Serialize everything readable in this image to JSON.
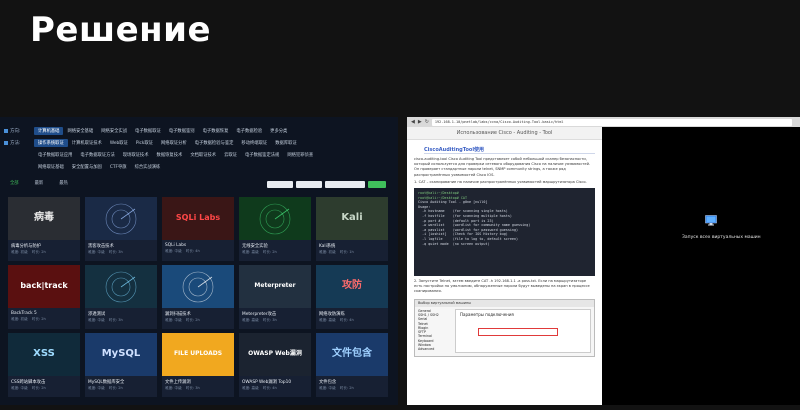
{
  "slide": {
    "title": "Решение"
  },
  "left": {
    "nav_rows": [
      {
        "label": "方向:",
        "cats": [
          "计算机基础",
          "网络安全基础",
          "网络安全实战",
          "电子数据取证",
          "电子数据鉴别",
          "电子数据恢复",
          "电子数据检验",
          "更多分类"
        ],
        "active": 0
      },
      {
        "label": "方法:",
        "cats": [
          "操作系统取证",
          "计算机取证技术",
          "Web取证",
          "Pick取证",
          "网络取证分析",
          "电子数据检验与鉴定",
          "移动终端取证",
          "数据库取证"
        ],
        "active": 0
      },
      {
        "label": "",
        "cats": [
          "电子数据取证应用",
          "电子数据取证方法",
          "现场取证技术",
          "数据恢复技术",
          "文档取证技术",
          "云取证",
          "电子数据鉴定法规",
          "网络犯罪侦查"
        ],
        "active": -1
      },
      {
        "label": "",
        "cats": [
          "网络取证基础",
          "安全配置与加固",
          "CTF夺旗",
          "综合实战演练"
        ],
        "active": -1
      }
    ],
    "filters": [
      "全部",
      "最新",
      "最热"
    ],
    "active_filter": 0,
    "cards": [
      {
        "name": "病毒分析与防护",
        "meta": [
          "难度: 初级",
          "时长: 2h"
        ],
        "thumb_text": "病毒",
        "bg": "#2a2d33",
        "fg": "#e8e8e8"
      },
      {
        "name": "黑客攻击技术",
        "meta": [
          "难度: 中级",
          "时长: 3h"
        ],
        "thumb_text": "",
        "bg": "#1a2a46",
        "fg": "#9fc2ff"
      },
      {
        "name": "SQLi Labs",
        "meta": [
          "难度: 中级",
          "时长: 4h"
        ],
        "thumb_text": "SQLi Labs",
        "bg": "#3a1616",
        "fg": "#ff4747"
      },
      {
        "name": "无线安全实验",
        "meta": [
          "难度: 高级",
          "时长: 2h"
        ],
        "thumb_text": "",
        "bg": "#0f3a1c",
        "fg": "#44e07a"
      },
      {
        "name": "Kali系统",
        "meta": [
          "难度: 初级",
          "时长: 1h"
        ],
        "thumb_text": "Kali",
        "bg": "#2d3c2e",
        "fg": "#c8d8c8"
      },
      {
        "name": "BackTrack 5",
        "meta": [
          "难度: 初级",
          "时长: 2h"
        ],
        "thumb_text": "back|track",
        "bg": "#5a1010",
        "fg": "#ffffff"
      },
      {
        "name": "渗透测试",
        "meta": [
          "难度: 中级",
          "时长: 3h"
        ],
        "thumb_text": "",
        "bg": "#143040",
        "fg": "#7fd7ff"
      },
      {
        "name": "漏洞扫描技术",
        "meta": [
          "难度: 中级",
          "时长: 2h"
        ],
        "thumb_text": "",
        "bg": "#1a4a7a",
        "fg": "#ffffff"
      },
      {
        "name": "Meterpreter攻击",
        "meta": [
          "难度: 高级",
          "时长: 3h"
        ],
        "thumb_text": "Meterpreter",
        "bg": "#223040",
        "fg": "#ffffff"
      },
      {
        "name": "网络攻防演练",
        "meta": [
          "难度: 高级",
          "时长: 4h"
        ],
        "thumb_text": "攻防",
        "bg": "#153a55",
        "fg": "#ff6b6b"
      },
      {
        "name": "CSS跨站脚本攻击",
        "meta": [
          "难度: 中级",
          "时长: 2h"
        ],
        "thumb_text": "XSS",
        "bg": "#102a3a",
        "fg": "#9fdcff"
      },
      {
        "name": "MySQL数据库安全",
        "meta": [
          "难度: 中级",
          "时长: 2h"
        ],
        "thumb_text": "MySQL",
        "bg": "#1a3a6a",
        "fg": "#cfe0ff"
      },
      {
        "name": "文件上传漏洞",
        "meta": [
          "难度: 中级",
          "时长: 3h"
        ],
        "thumb_text": "FILE UPLOADS",
        "bg": "#f1a81f",
        "fg": "#ffffff"
      },
      {
        "name": "OWASP Web漏洞 Top10",
        "meta": [
          "难度: 高级",
          "时长: 4h"
        ],
        "thumb_text": "OWASP Web漏洞",
        "bg": "#1b2330",
        "fg": "#ffffff"
      },
      {
        "name": "文件包含",
        "meta": [
          "难度: 中级",
          "时长: 2h"
        ],
        "thumb_text": "文件包含",
        "bg": "#1a3a6a",
        "fg": "#9fd0ff"
      }
    ]
  },
  "right": {
    "browser": {
      "back": "◀",
      "forward": "▶",
      "reload": "↻",
      "url": "192.168.1.10/pnetlab/labs/ccna/Cisco-Auditing-Tool-basic/html"
    },
    "doc_header": "Использование Cisco - Auditing - Tool",
    "doc_heading": "CiscoAuditingTool使用",
    "paragraphs": [
      "cisco-auditing-tool  Cisco Auditing Tool представляет собой небольшой сканер безопасности, который используется для проверки сетевого оборудования Cisco на наличие уязвимостей. Он проверяет стандартные пароли telnet, SNMP community strings, а также ряд распространённых уязвимостей Cisco IOS.",
      "1. CAT – сканирование на наличие распространённых уязвимостей маршрутизатора Cisco."
    ],
    "terminal_lines": [
      "root@kali:~/Desktop#",
      "root@kali:~/Desktop# CAT",
      "",
      "Cisco Auditing Tool - g0ne [null0]",
      "Usage:",
      "  -h hostname    (for scanning single hosts)",
      "  -f hostfile    (for scanning multiple hosts)",
      "  -p port #      (default port is 23)",
      "  -w wordlist    (wordlist for community name guessing)",
      "  -a passlist    (wordlist for password guessing)",
      "  -i [ioshist]   (Check for IOS History bug)",
      "  -l logfile     (file to log to, default screen)",
      "  -q quiet mode  (no screen output)"
    ],
    "after_term": "2. Запустите Telnet, затем введите CAT -h 192.168.1.1 -a pass.txt. Если на маршрутизаторе есть настройки по умолчанию, обнаруженные пароли будут выведены на экран в процессе сканирования.",
    "window_title": "Выбор виртуальной машины",
    "window_tree": [
      "General",
      "SSH1 / SSH2",
      "Serial",
      "Telnet",
      "Rlogin",
      "SFTP",
      "Terminal",
      "Keyboard",
      "Window",
      "Advanced"
    ],
    "window_pane_header": "Параметры подключения",
    "vm_label": "Запуск всех виртуальных машин"
  }
}
